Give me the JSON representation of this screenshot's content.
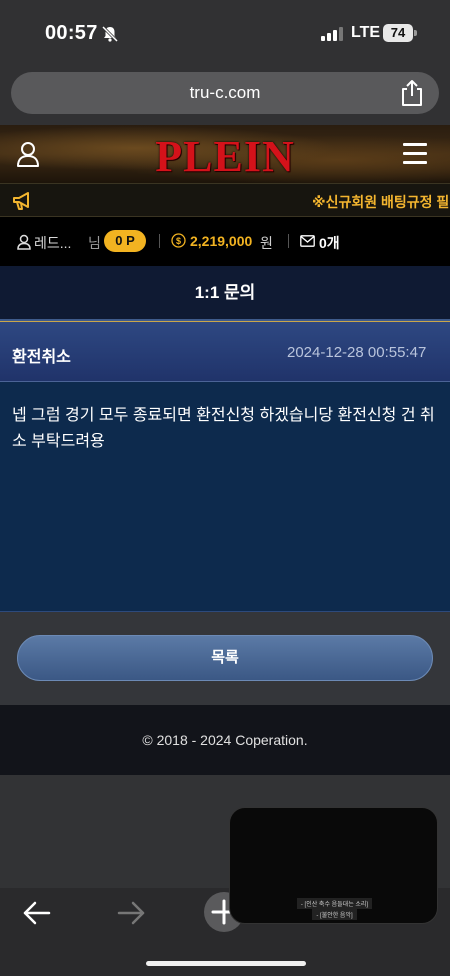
{
  "status_bar": {
    "time": "00:57",
    "network": "LTE",
    "battery": "74"
  },
  "browser": {
    "url": "tru-c.com"
  },
  "site": {
    "logo": "PLEIN",
    "marquee": "※신규회원 배팅규정 필",
    "brand_color": "#d4121a",
    "accent_color": "#f2b321"
  },
  "user": {
    "name": "레드...",
    "honorific": "님",
    "points": "0 P",
    "balance": "2,219,000",
    "currency": "원",
    "messages": "0개"
  },
  "page": {
    "title": "1:1 문의"
  },
  "message": {
    "subject": "환전취소",
    "date": "2024-12-28 00:55:47",
    "body": "넵 그럼 경기 모두 종료되면 환전신청 하겠습니당 환전신청 건 취소 부탁드려용"
  },
  "actions": {
    "list_button": "목록"
  },
  "footer": {
    "copyright": "© 2018 - 2024 Coperation."
  },
  "pip": {
    "caption_line1": "- [인산 축수 음들대는 소리]",
    "caption_line2": "- [불안한 음악]"
  },
  "icons": {
    "bell": "bell-slash-icon",
    "share": "share-icon",
    "user": "user-icon",
    "menu": "hamburger-menu-icon",
    "megaphone": "megaphone-icon",
    "coin": "coin-icon",
    "mail": "mail-icon",
    "back": "back-arrow-icon",
    "forward": "forward-arrow-icon",
    "new_tab": "plus-icon"
  }
}
